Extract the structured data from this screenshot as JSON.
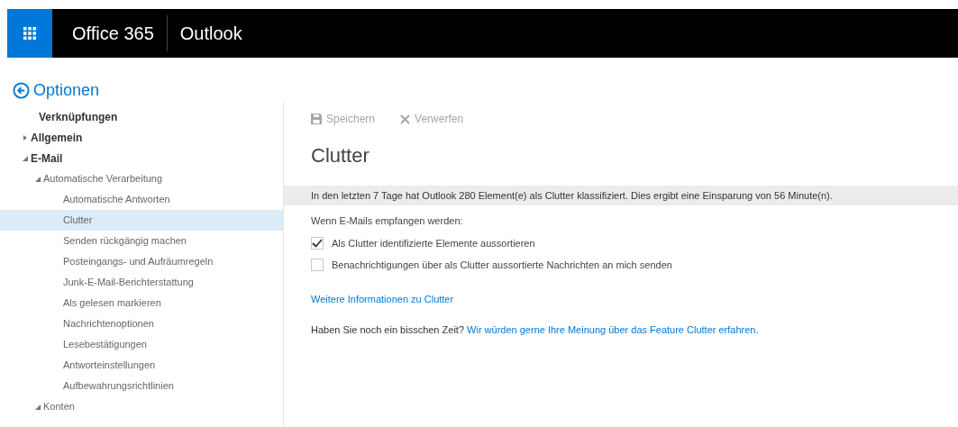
{
  "header": {
    "suite": "Office 365",
    "app": "Outlook"
  },
  "options": {
    "back_title": "Optionen"
  },
  "sidebar": {
    "items": [
      {
        "label": "Verknüpfungen",
        "selected": false
      },
      {
        "label": "Allgemein",
        "expanded": false,
        "selected": false
      },
      {
        "label": "E-Mail",
        "expanded": true,
        "selected": false,
        "children": [
          {
            "label": "Automatische Verarbeitung",
            "expanded": true,
            "selected": false,
            "children": [
              {
                "label": "Automatische Antworten",
                "selected": false
              },
              {
                "label": "Clutter",
                "selected": true
              },
              {
                "label": "Senden rückgängig machen",
                "selected": false
              },
              {
                "label": "Posteingangs- und Aufräumregeln",
                "selected": false
              },
              {
                "label": "Junk-E-Mail-Berichterstattung",
                "selected": false
              },
              {
                "label": "Als gelesen markieren",
                "selected": false
              },
              {
                "label": "Nachrichtenoptionen",
                "selected": false
              },
              {
                "label": "Lesebestätigungen",
                "selected": false
              },
              {
                "label": "Antworteinstellungen",
                "selected": false
              },
              {
                "label": "Aufbewahrungsrichtlinien",
                "selected": false
              }
            ]
          },
          {
            "label": "Konten",
            "expanded": true,
            "selected": false
          }
        ]
      }
    ]
  },
  "toolbar": [
    {
      "kind": "save",
      "label": "Speichern",
      "disabled": true
    },
    {
      "kind": "discard",
      "label": "Verwerfen",
      "disabled": true
    }
  ],
  "content": {
    "title": "Clutter",
    "info": "In den letzten 7 Tage hat Outlook 280 Element(e) als Clutter klassifiziert. Dies ergibt eine Einsparung von 56 Minute(n).",
    "intro": "Wenn E-Mails empfangen werden:",
    "options": [
      {
        "label": "Als Clutter identifizierte Elemente aussortieren",
        "checked": true
      },
      {
        "label": "Benachrichtigungen über als Clutter aussortierte Nachrichten an mich senden",
        "checked": false
      }
    ],
    "more_link": "Weitere Informationen zu Clutter",
    "feedback_prompt": "Haben Sie noch ein bisschen Zeit?",
    "feedback_link": "Wir würden gerne Ihre Meinung über das Feature Clutter erfahren."
  }
}
